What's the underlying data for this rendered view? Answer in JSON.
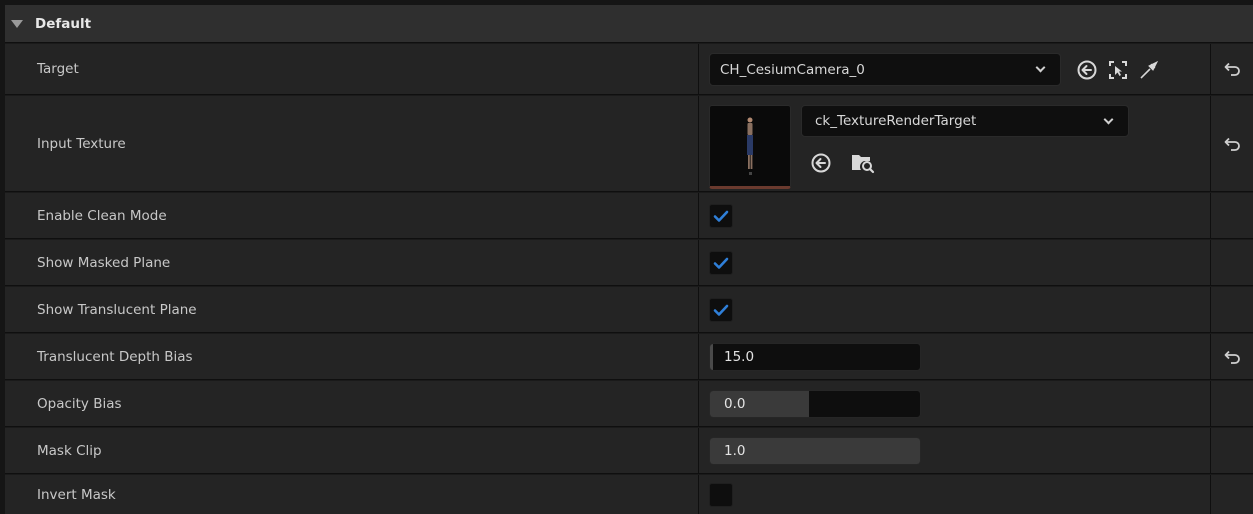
{
  "category": {
    "title": "Default"
  },
  "target": {
    "label": "Target",
    "value": "CH_CesiumCamera_0"
  },
  "input_texture": {
    "label": "Input Texture",
    "value": "ck_TextureRenderTarget"
  },
  "enable_clean_mode": {
    "label": "Enable Clean Mode",
    "checked": true
  },
  "show_masked_plane": {
    "label": "Show Masked Plane",
    "checked": true
  },
  "show_translucent_plane": {
    "label": "Show Translucent Plane",
    "checked": true
  },
  "translucent_depth_bias": {
    "label": "Translucent Depth Bias",
    "value": "15.0"
  },
  "opacity_bias": {
    "label": "Opacity Bias",
    "value": "0.0",
    "fill_fraction": 0.47
  },
  "mask_clip": {
    "label": "Mask Clip",
    "value": "1.0",
    "fill_fraction": 1.0
  },
  "invert_mask": {
    "label": "Invert Mask",
    "checked": false
  },
  "colors": {
    "accent": "#2f7fd8",
    "row_bg": "#242424",
    "header_bg": "#2f2f2f"
  }
}
